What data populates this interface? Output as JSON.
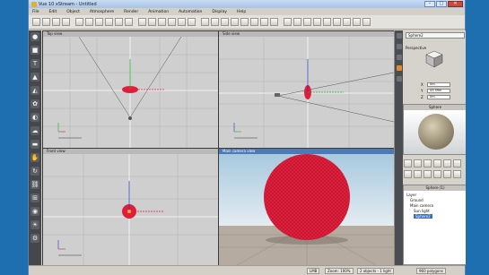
{
  "window": {
    "title": "Vue 10 xStream - Untitled",
    "controls": [
      "–",
      "□",
      "✕"
    ]
  },
  "menu": [
    "File",
    "Edit",
    "Object",
    "Atmosphere",
    "Render",
    "Animation",
    "Automation",
    "Display",
    "Help"
  ],
  "toolbar_icons": [
    "new-icon",
    "open-icon",
    "save-icon",
    "print-icon",
    "undo-icon",
    "redo-icon",
    "cut-icon",
    "copy-icon",
    "paste-icon",
    "delete-icon",
    "select-icon",
    "move-icon",
    "rotate-icon",
    "scale-icon",
    "render-icon",
    "render-area-icon",
    "atmosphere-icon",
    "terrain-icon",
    "plant-icon",
    "rock-icon",
    "cloud-icon",
    "camera-icon",
    "light-icon",
    "material-icon",
    "wire-icon",
    "shade-icon",
    "texture-icon",
    "zoom-icon",
    "pan-icon",
    "fit-icon",
    "grid-icon",
    "snap-icon",
    "help-icon"
  ],
  "left_tools": [
    {
      "name": "sphere-tool-icon",
      "glyph": "●"
    },
    {
      "name": "cube-tool-icon",
      "glyph": "■"
    },
    {
      "name": "text-tool-icon",
      "glyph": "T"
    },
    {
      "name": "terrain-tool-icon",
      "glyph": "▲"
    },
    {
      "name": "mountain-tool-icon",
      "glyph": "◭"
    },
    {
      "name": "plant-tool-icon",
      "glyph": "✿"
    },
    {
      "name": "rock-tool-icon",
      "glyph": "◐"
    },
    {
      "name": "cloud-tool-icon",
      "glyph": "☁"
    },
    {
      "name": "water-tool-icon",
      "glyph": "▬"
    },
    {
      "name": "hand-tool-icon",
      "glyph": "✋"
    },
    {
      "name": "rotate-tool-icon",
      "glyph": "↻"
    },
    {
      "name": "link-tool-icon",
      "glyph": "⛓"
    },
    {
      "name": "group-tool-icon",
      "glyph": "⊞"
    },
    {
      "name": "eye-tool-icon",
      "glyph": "◉"
    },
    {
      "name": "sun-tool-icon",
      "glyph": "☀"
    },
    {
      "name": "settings-tool-icon",
      "glyph": "⚙"
    }
  ],
  "viewports": {
    "top": {
      "label": "Top view"
    },
    "side": {
      "label": "Side view"
    },
    "front": {
      "label": "Front view"
    },
    "camera": {
      "label": "Main camera view"
    }
  },
  "right_panel": {
    "object_name": "Sphere2",
    "projection": "Perspective",
    "coords": [
      {
        "axis": "X",
        "value": "0m"
      },
      {
        "axis": "Y",
        "value": "43.59m"
      },
      {
        "axis": "Z",
        "value": "0m"
      }
    ],
    "preview_label": "Sphere",
    "scene_tab": "Sphere (1)",
    "scene_items": [
      "Layer",
      "Ground",
      "Main camera",
      "Sun light",
      "Sphere2"
    ],
    "selected_index": 4
  },
  "status": {
    "left": "LMB",
    "zoom": "Zoom: 100%",
    "objects": "2 objects - 1 light",
    "polygons": "960 polygons"
  },
  "colors": {
    "sphere": "#e01e3c",
    "viewport_bg": "#cfcfcf",
    "camera_header": "#4d79b5",
    "selection": "#3a6fc4"
  }
}
